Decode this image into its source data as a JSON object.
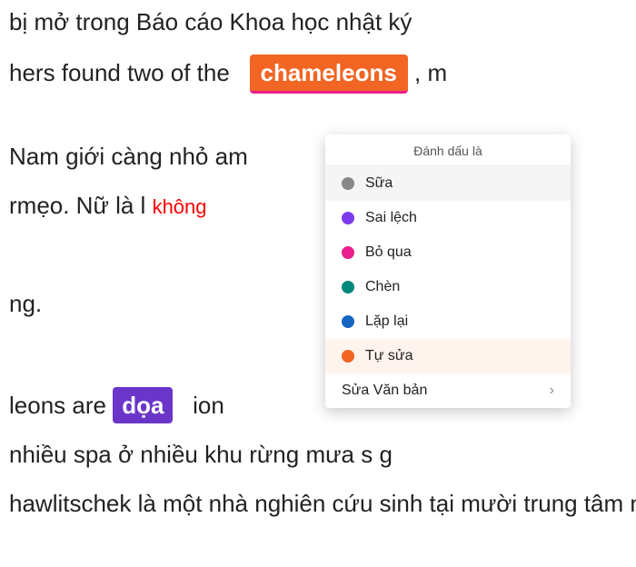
{
  "lines": {
    "line1": "bị mở trong Báo cáo Khoa học nhật ký",
    "line2_before": "hers found two of the",
    "chameleons": "chameleons",
    "line2_after": ", m",
    "line3": "Nam giới càng nhỏ",
    "line3_suffix": "am",
    "line4_before": "rmẹo. Nữ là l",
    "line4_suffix": "không",
    "line5": "ng.",
    "line6_before": "leons are ",
    "highlight_doa": "dọa",
    "line6_after": "ion",
    "line7": "nhiều spa ở nhiều khu rừng mưa",
    "line7_suffix": "s g",
    "line8": "hawlitschek là một nhà nghiên cứu sinh tại mười trung tâm",
    "line8_suffix": "n"
  },
  "dropdown": {
    "header": "Đánh dấu là",
    "items": [
      {
        "id": "sua",
        "label": "Sữa",
        "dot_color": "gray",
        "selected": true,
        "active": false
      },
      {
        "id": "sai-lech",
        "label": "Sai lệch",
        "dot_color": "purple",
        "selected": false,
        "active": false
      },
      {
        "id": "bo-qua",
        "label": "Bỏ qua",
        "dot_color": "pink",
        "selected": false,
        "active": false
      },
      {
        "id": "chen",
        "label": "Chèn",
        "dot_color": "teal",
        "selected": false,
        "active": false
      },
      {
        "id": "lap-lai",
        "label": "Lặp lại",
        "dot_color": "blue",
        "selected": false,
        "active": false
      },
      {
        "id": "tu-sua",
        "label": "Tự sửa",
        "dot_color": "orange",
        "selected": false,
        "active": true
      }
    ],
    "sub_menu": "Sửa Văn bản"
  }
}
